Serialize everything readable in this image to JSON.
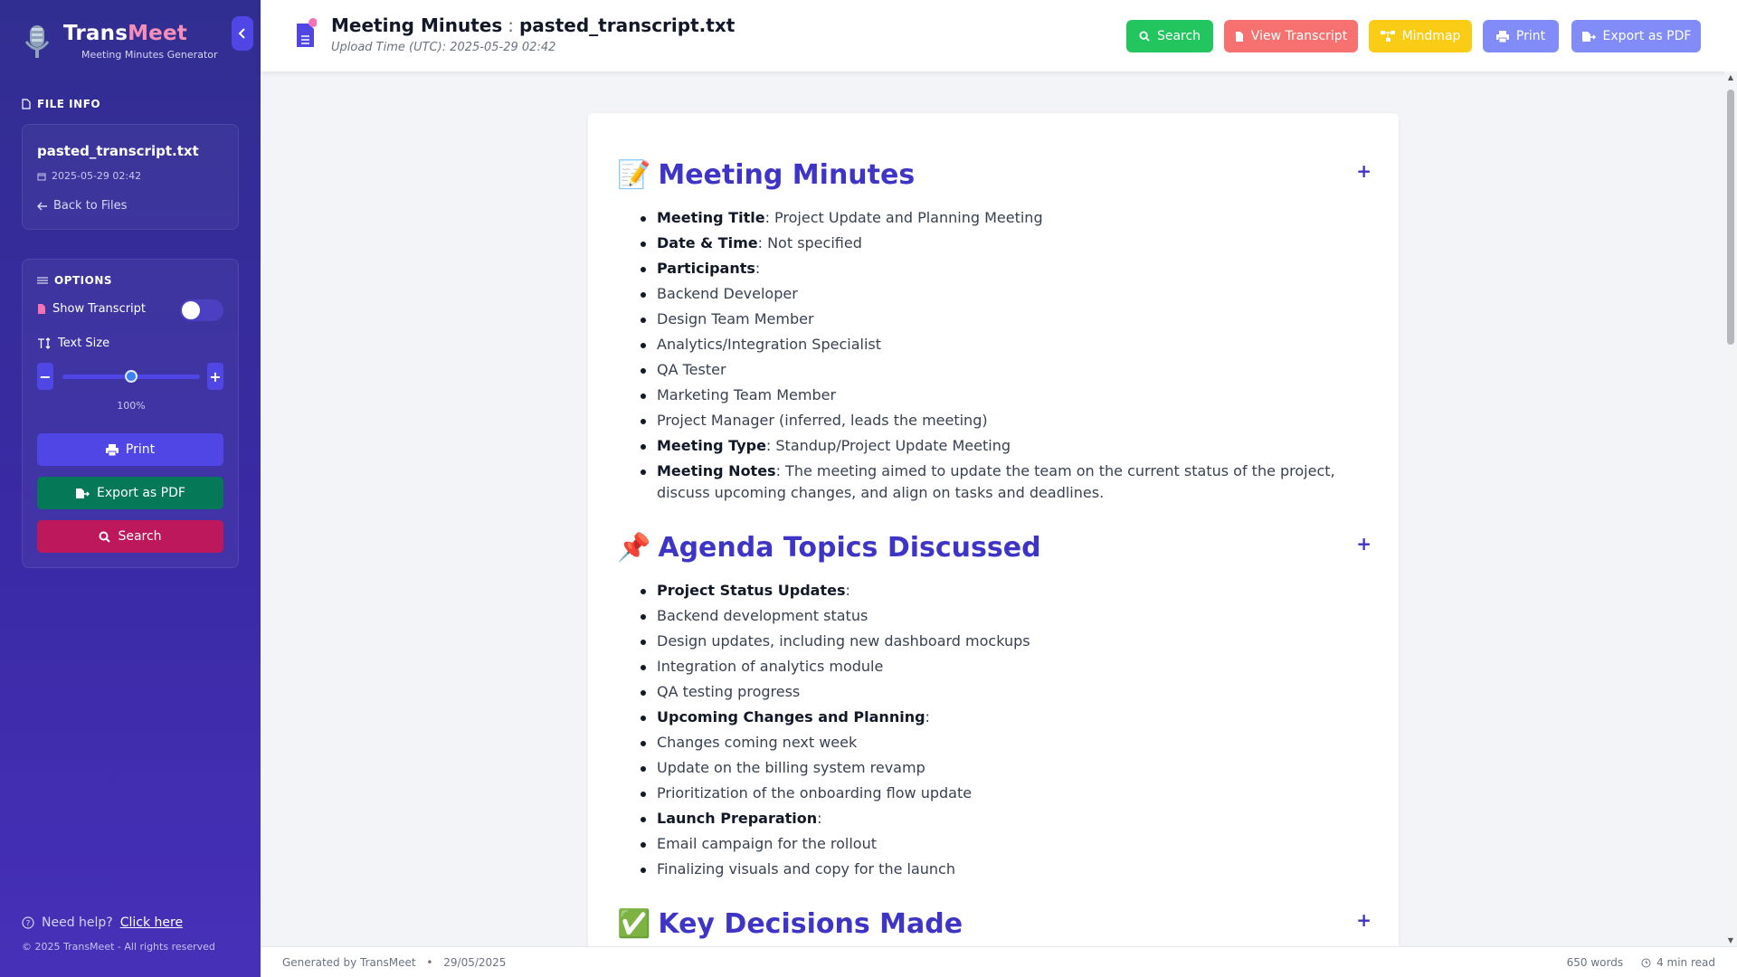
{
  "brand": {
    "name_a": "Trans",
    "name_b": "Meet",
    "subtitle": "Meeting Minutes Generator"
  },
  "sidebar": {
    "file_info": {
      "title": "FILE INFO",
      "file_name": "pasted_transcript.txt",
      "date": "2025-05-29 02:42",
      "back_label": "Back to Files"
    },
    "options": {
      "title": "OPTIONS",
      "show_transcript_label": "Show Transcript",
      "show_transcript_on": false,
      "text_size_label": "Text Size",
      "text_size_value": "100%",
      "text_size_percent": 50,
      "buttons": {
        "print": "Print",
        "export": "Export as PDF",
        "search": "Search"
      }
    },
    "help_text": "Need help?",
    "help_link": "Click here",
    "copyright": "© 2025 TransMeet - All rights reserved"
  },
  "header": {
    "title": "Meeting Minutes",
    "separator": ":",
    "file_name": "pasted_transcript.txt",
    "upload_time": "Upload Time (UTC): 2025-05-29 02:42",
    "buttons": {
      "search": "Search",
      "view_transcript": "View Transcript",
      "mindmap": "Mindmap",
      "print": "Print",
      "export": "Export as PDF"
    }
  },
  "colors": {
    "accent": "#3e34c6",
    "search": "#22c55e",
    "view_transcript": "#f87171",
    "mindmap": "#facc15",
    "print": "#818cf8",
    "export": "#818cf8",
    "side_print": "#4f46e5",
    "side_export": "#047857",
    "side_search": "#be185d"
  },
  "document": {
    "sections": [
      {
        "emoji": "📝",
        "heading": "Meeting Minutes",
        "items": [
          {
            "bold": "Meeting Title",
            "text": ": Project Update and Planning Meeting"
          },
          {
            "bold": "Date & Time",
            "text": ": Not specified"
          },
          {
            "bold": "Participants",
            "text": ":"
          },
          {
            "bold": "",
            "text": "Backend Developer"
          },
          {
            "bold": "",
            "text": "Design Team Member"
          },
          {
            "bold": "",
            "text": "Analytics/Integration Specialist"
          },
          {
            "bold": "",
            "text": "QA Tester"
          },
          {
            "bold": "",
            "text": "Marketing Team Member"
          },
          {
            "bold": "",
            "text": "Project Manager (inferred, leads the meeting)"
          },
          {
            "bold": "Meeting Type",
            "text": ": Standup/Project Update Meeting"
          },
          {
            "bold": "Meeting Notes",
            "text": ": The meeting aimed to update the team on the current status of the project, discuss upcoming changes, and align on tasks and deadlines."
          }
        ]
      },
      {
        "emoji": "📌",
        "heading": "Agenda Topics Discussed",
        "items": [
          {
            "bold": "Project Status Updates",
            "text": ":"
          },
          {
            "bold": "",
            "text": "Backend development status"
          },
          {
            "bold": "",
            "text": "Design updates, including new dashboard mockups"
          },
          {
            "bold": "",
            "text": "Integration of analytics module"
          },
          {
            "bold": "",
            "text": "QA testing progress"
          },
          {
            "bold": "Upcoming Changes and Planning",
            "text": ":"
          },
          {
            "bold": "",
            "text": "Changes coming next week"
          },
          {
            "bold": "",
            "text": "Update on the billing system revamp"
          },
          {
            "bold": "",
            "text": "Prioritization of the onboarding flow update"
          },
          {
            "bold": "Launch Preparation",
            "text": ":"
          },
          {
            "bold": "",
            "text": "Email campaign for the rollout"
          },
          {
            "bold": "",
            "text": "Finalizing visuals and copy for the launch"
          }
        ]
      },
      {
        "emoji": "✅",
        "heading": "Key Decisions Made",
        "items": []
      }
    ],
    "expand_symbol": "+"
  },
  "footer": {
    "generated": "Generated by TransMeet",
    "bullet": "•",
    "date": "29/05/2025",
    "words": "650 words",
    "read_time": "4 min read"
  }
}
